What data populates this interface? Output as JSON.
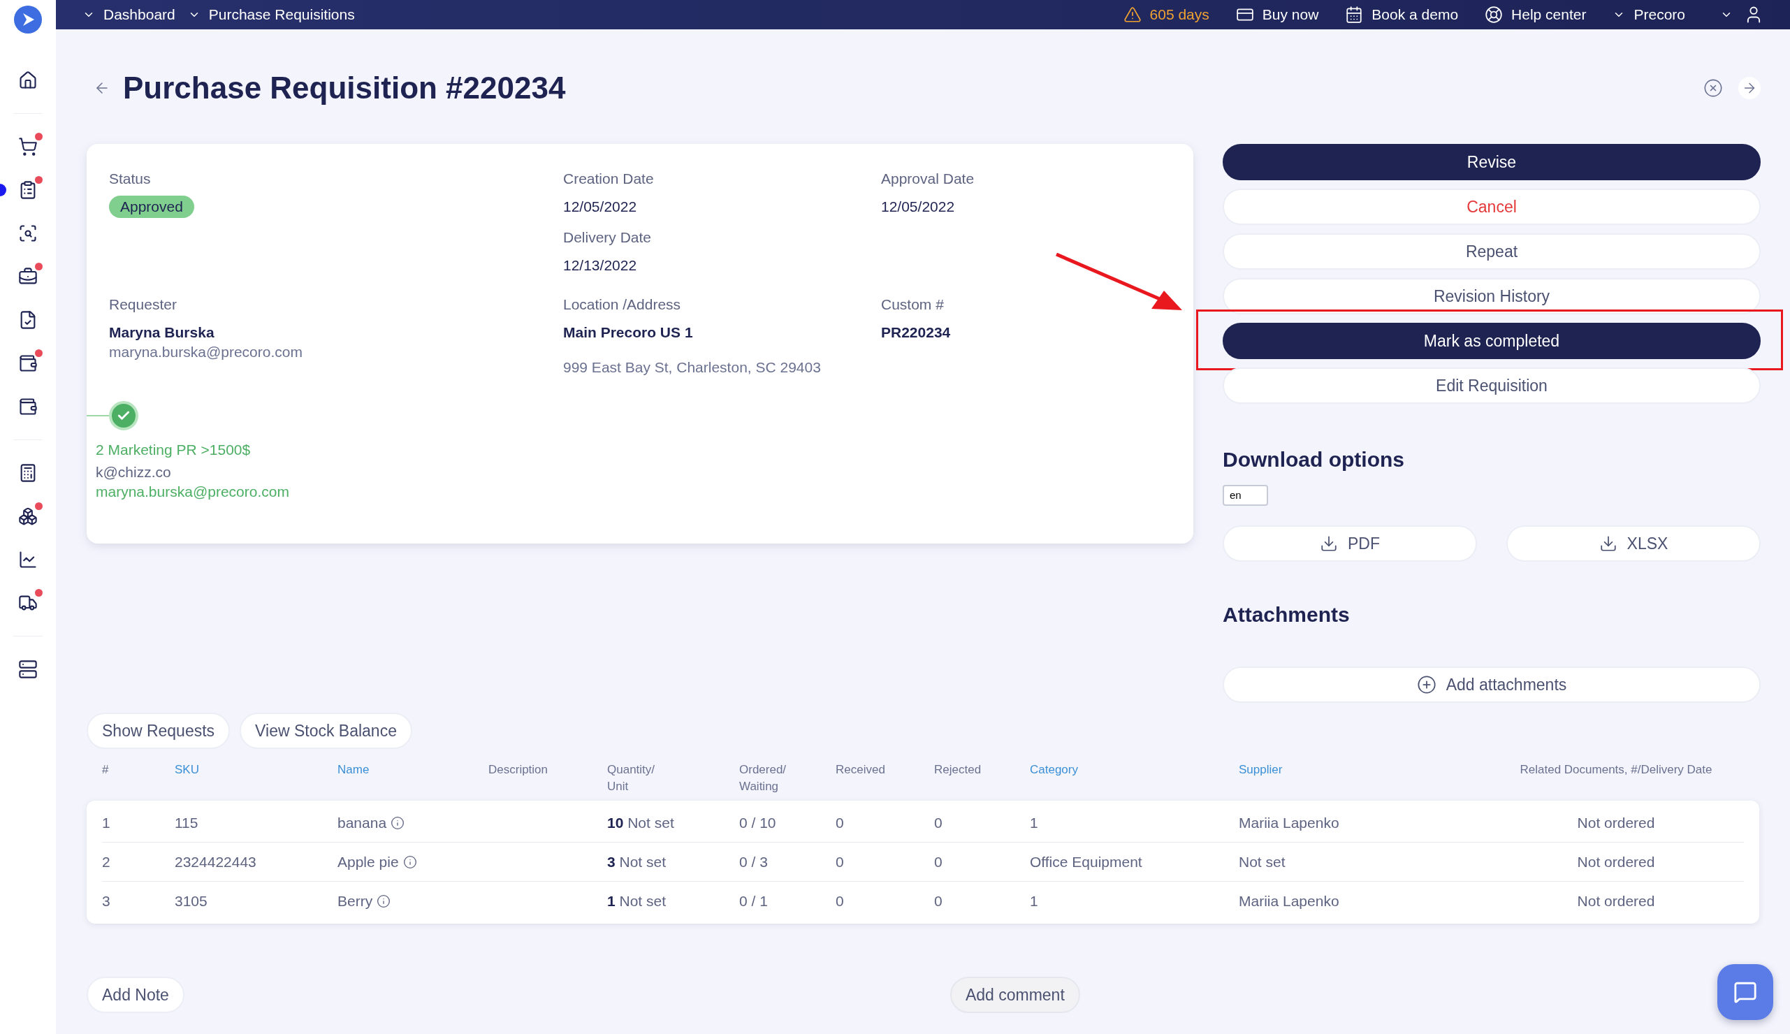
{
  "sidebar": {
    "items": [
      {
        "badge": false,
        "selected": false
      },
      {
        "badge": true,
        "selected": false
      },
      {
        "badge": true,
        "selected": true
      },
      {
        "badge": false,
        "selected": false
      },
      {
        "badge": true,
        "selected": false
      },
      {
        "badge": false,
        "selected": false
      },
      {
        "badge": true,
        "selected": false
      },
      {
        "badge": false,
        "selected": false
      },
      {
        "badge": false,
        "selected": false
      },
      {
        "badge": true,
        "selected": false
      },
      {
        "badge": false,
        "selected": false
      },
      {
        "badge": true,
        "selected": false
      },
      {
        "badge": false,
        "selected": false
      }
    ]
  },
  "top_bar": {
    "breadcrumbs": [
      "Dashboard",
      "Purchase Requisitions"
    ],
    "trial": "605 days",
    "links": [
      "Buy now",
      "Book a demo",
      "Help center"
    ],
    "company": "Precoro"
  },
  "title": "Purchase Requisition #220234",
  "details": {
    "status_label": "Status",
    "status": "Approved",
    "fields": [
      {
        "label": "Creation Date",
        "value": "12/05/2022"
      },
      {
        "label": "Approval Date",
        "value": "12/05/2022"
      },
      {
        "label": "Delivery Date",
        "value": "12/13/2022"
      }
    ],
    "requester": {
      "label": "Requester",
      "name": "Maryna Burska",
      "email": "maryna.burska@precoro.com"
    },
    "location": {
      "label": "Location /Address",
      "name": "Main Precoro US 1",
      "address": "999 East Bay St, Charleston, SC 29403"
    },
    "custom": {
      "label": "Custom #",
      "value": "PR220234"
    },
    "approval": {
      "done": true,
      "step": "2 Marketing PR >1500$",
      "approver": "k@chizz.co",
      "email": "maryna.burska@precoro.com"
    }
  },
  "actions": [
    {
      "label": "Revise",
      "kind": "primary",
      "highlighted": false
    },
    {
      "label": "Cancel",
      "kind": "danger",
      "highlighted": false
    },
    {
      "label": "Repeat",
      "kind": "secondary",
      "highlighted": false
    },
    {
      "label": "Revision History",
      "kind": "secondary",
      "highlighted": false
    },
    {
      "label": "Mark as completed",
      "kind": "primary",
      "highlighted": true
    },
    {
      "label": "Edit Requisition",
      "kind": "secondary",
      "highlighted": false
    }
  ],
  "download": {
    "title": "Download options",
    "language": "en",
    "formats": [
      "PDF",
      "XLSX"
    ]
  },
  "attachments": {
    "title": "Attachments",
    "add": "Add attachments"
  },
  "table_tabs": [
    "Show Requests",
    "View Stock Balance"
  ],
  "table": {
    "columns": [
      {
        "label": "#",
        "sortable": false
      },
      {
        "label": "SKU",
        "sortable": true
      },
      {
        "label": "Name",
        "sortable": true
      },
      {
        "label": "Description",
        "sortable": false
      },
      {
        "label": "Quantity/\nUnit",
        "sortable": false
      },
      {
        "label": "Ordered/\nWaiting",
        "sortable": false
      },
      {
        "label": "Received",
        "sortable": false
      },
      {
        "label": "Rejected",
        "sortable": false
      },
      {
        "label": "Category",
        "sortable": true
      },
      {
        "label": "Supplier",
        "sortable": true
      },
      {
        "label": "Related Documents, #/Delivery Date",
        "sortable": false
      }
    ],
    "rows": [
      {
        "cells": [
          "1",
          "115",
          "banana",
          "",
          "**10** Not set",
          "0 / 10",
          "0",
          "0",
          "1",
          "Mariia Lapenko",
          "Not ordered"
        ]
      },
      {
        "cells": [
          "2",
          "2324422443",
          "Apple pie",
          "",
          "**3** Not set",
          "0 / 3",
          "0",
          "0",
          "Office Equipment",
          "Not set",
          "Not ordered"
        ]
      },
      {
        "cells": [
          "3",
          "3105",
          "Berry",
          "",
          "**1** Not set",
          "0 / 1",
          "0",
          "0",
          "1",
          "Mariia Lapenko",
          "Not ordered"
        ]
      }
    ]
  },
  "footer_buttons": [
    "Add Note",
    "Add comment"
  ]
}
